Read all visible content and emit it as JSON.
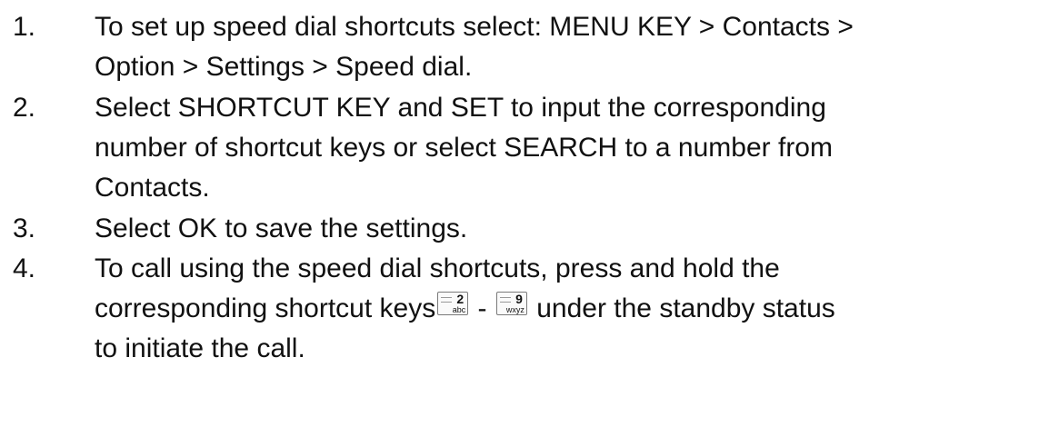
{
  "steps": [
    {
      "number": "1.",
      "lines": [
        "To set up speed dial shortcuts select: MENU KEY > Contacts >",
        "Option > Settings > Speed dial."
      ]
    },
    {
      "number": "2.",
      "lines": [
        "Select SHORTCUT KEY and SET to input the corresponding",
        "number of shortcut keys or select SEARCH to a number from",
        "Contacts."
      ]
    },
    {
      "number": "3.",
      "lines": [
        "Select OK to save the settings."
      ]
    },
    {
      "number": "4.",
      "lines": [
        "To call using the speed dial shortcuts, press and hold the"
      ],
      "line2_before": "corresponding shortcut keys",
      "line2_separator": " - ",
      "line2_after": " under the standby status",
      "line3": "to initiate the call."
    }
  ],
  "keys": {
    "key2": {
      "digit": "2",
      "letters": "abc",
      "icon": "keypad-2-key-icon"
    },
    "key9": {
      "digit": "9",
      "letters": "wxyz",
      "icon": "keypad-9-key-icon"
    }
  }
}
